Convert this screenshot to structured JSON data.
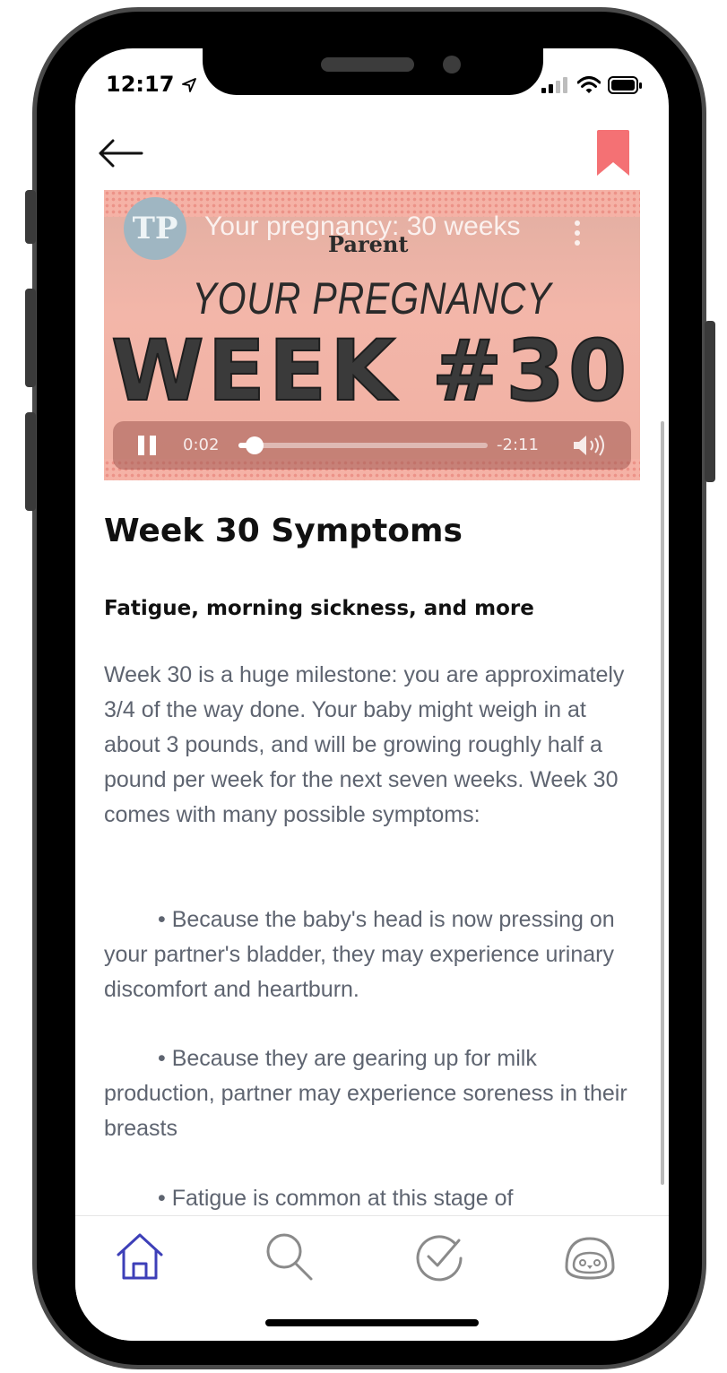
{
  "status_bar": {
    "time": "12:17"
  },
  "header": {
    "back_icon": "arrow-left-icon",
    "bookmark_icon": "bookmark-icon",
    "bookmark_color": "#f47174"
  },
  "video": {
    "channel_logo": "TP",
    "title": "Your pregnancy: 30 weeks",
    "brand": "Parent",
    "headline": "YOUR PREGNANCY",
    "week_label": "WEEK #30",
    "elapsed": "0:02",
    "remaining": "-2:11",
    "progress": 0.015
  },
  "article": {
    "title": "Week 30 Symptoms",
    "subtitle": "Fatigue, morning sickness, and more",
    "intro": "Week 30 is a huge milestone: you are approximately 3/4 of the way done. Your baby might weigh in at about 3 pounds, and will be growing roughly half a pound per week for the next seven weeks. Week 30 comes with many possible symptoms:",
    "bullets": [
      "• Because the baby's head is now pressing on your partner's bladder, they may experience urinary discomfort and heartburn.",
      "•  Because they are gearing up for milk production, partner may experience soreness in their breasts",
      "• Fatigue is common at this stage of"
    ]
  },
  "tab_bar": {
    "items": [
      {
        "icon": "home-icon",
        "active": true
      },
      {
        "icon": "search-icon",
        "active": false
      },
      {
        "icon": "checkmark-circle-icon",
        "active": false
      },
      {
        "icon": "penguin-icon",
        "active": false
      }
    ],
    "active_color": "#3d3fb8",
    "inactive_color": "#8a8a8a"
  }
}
